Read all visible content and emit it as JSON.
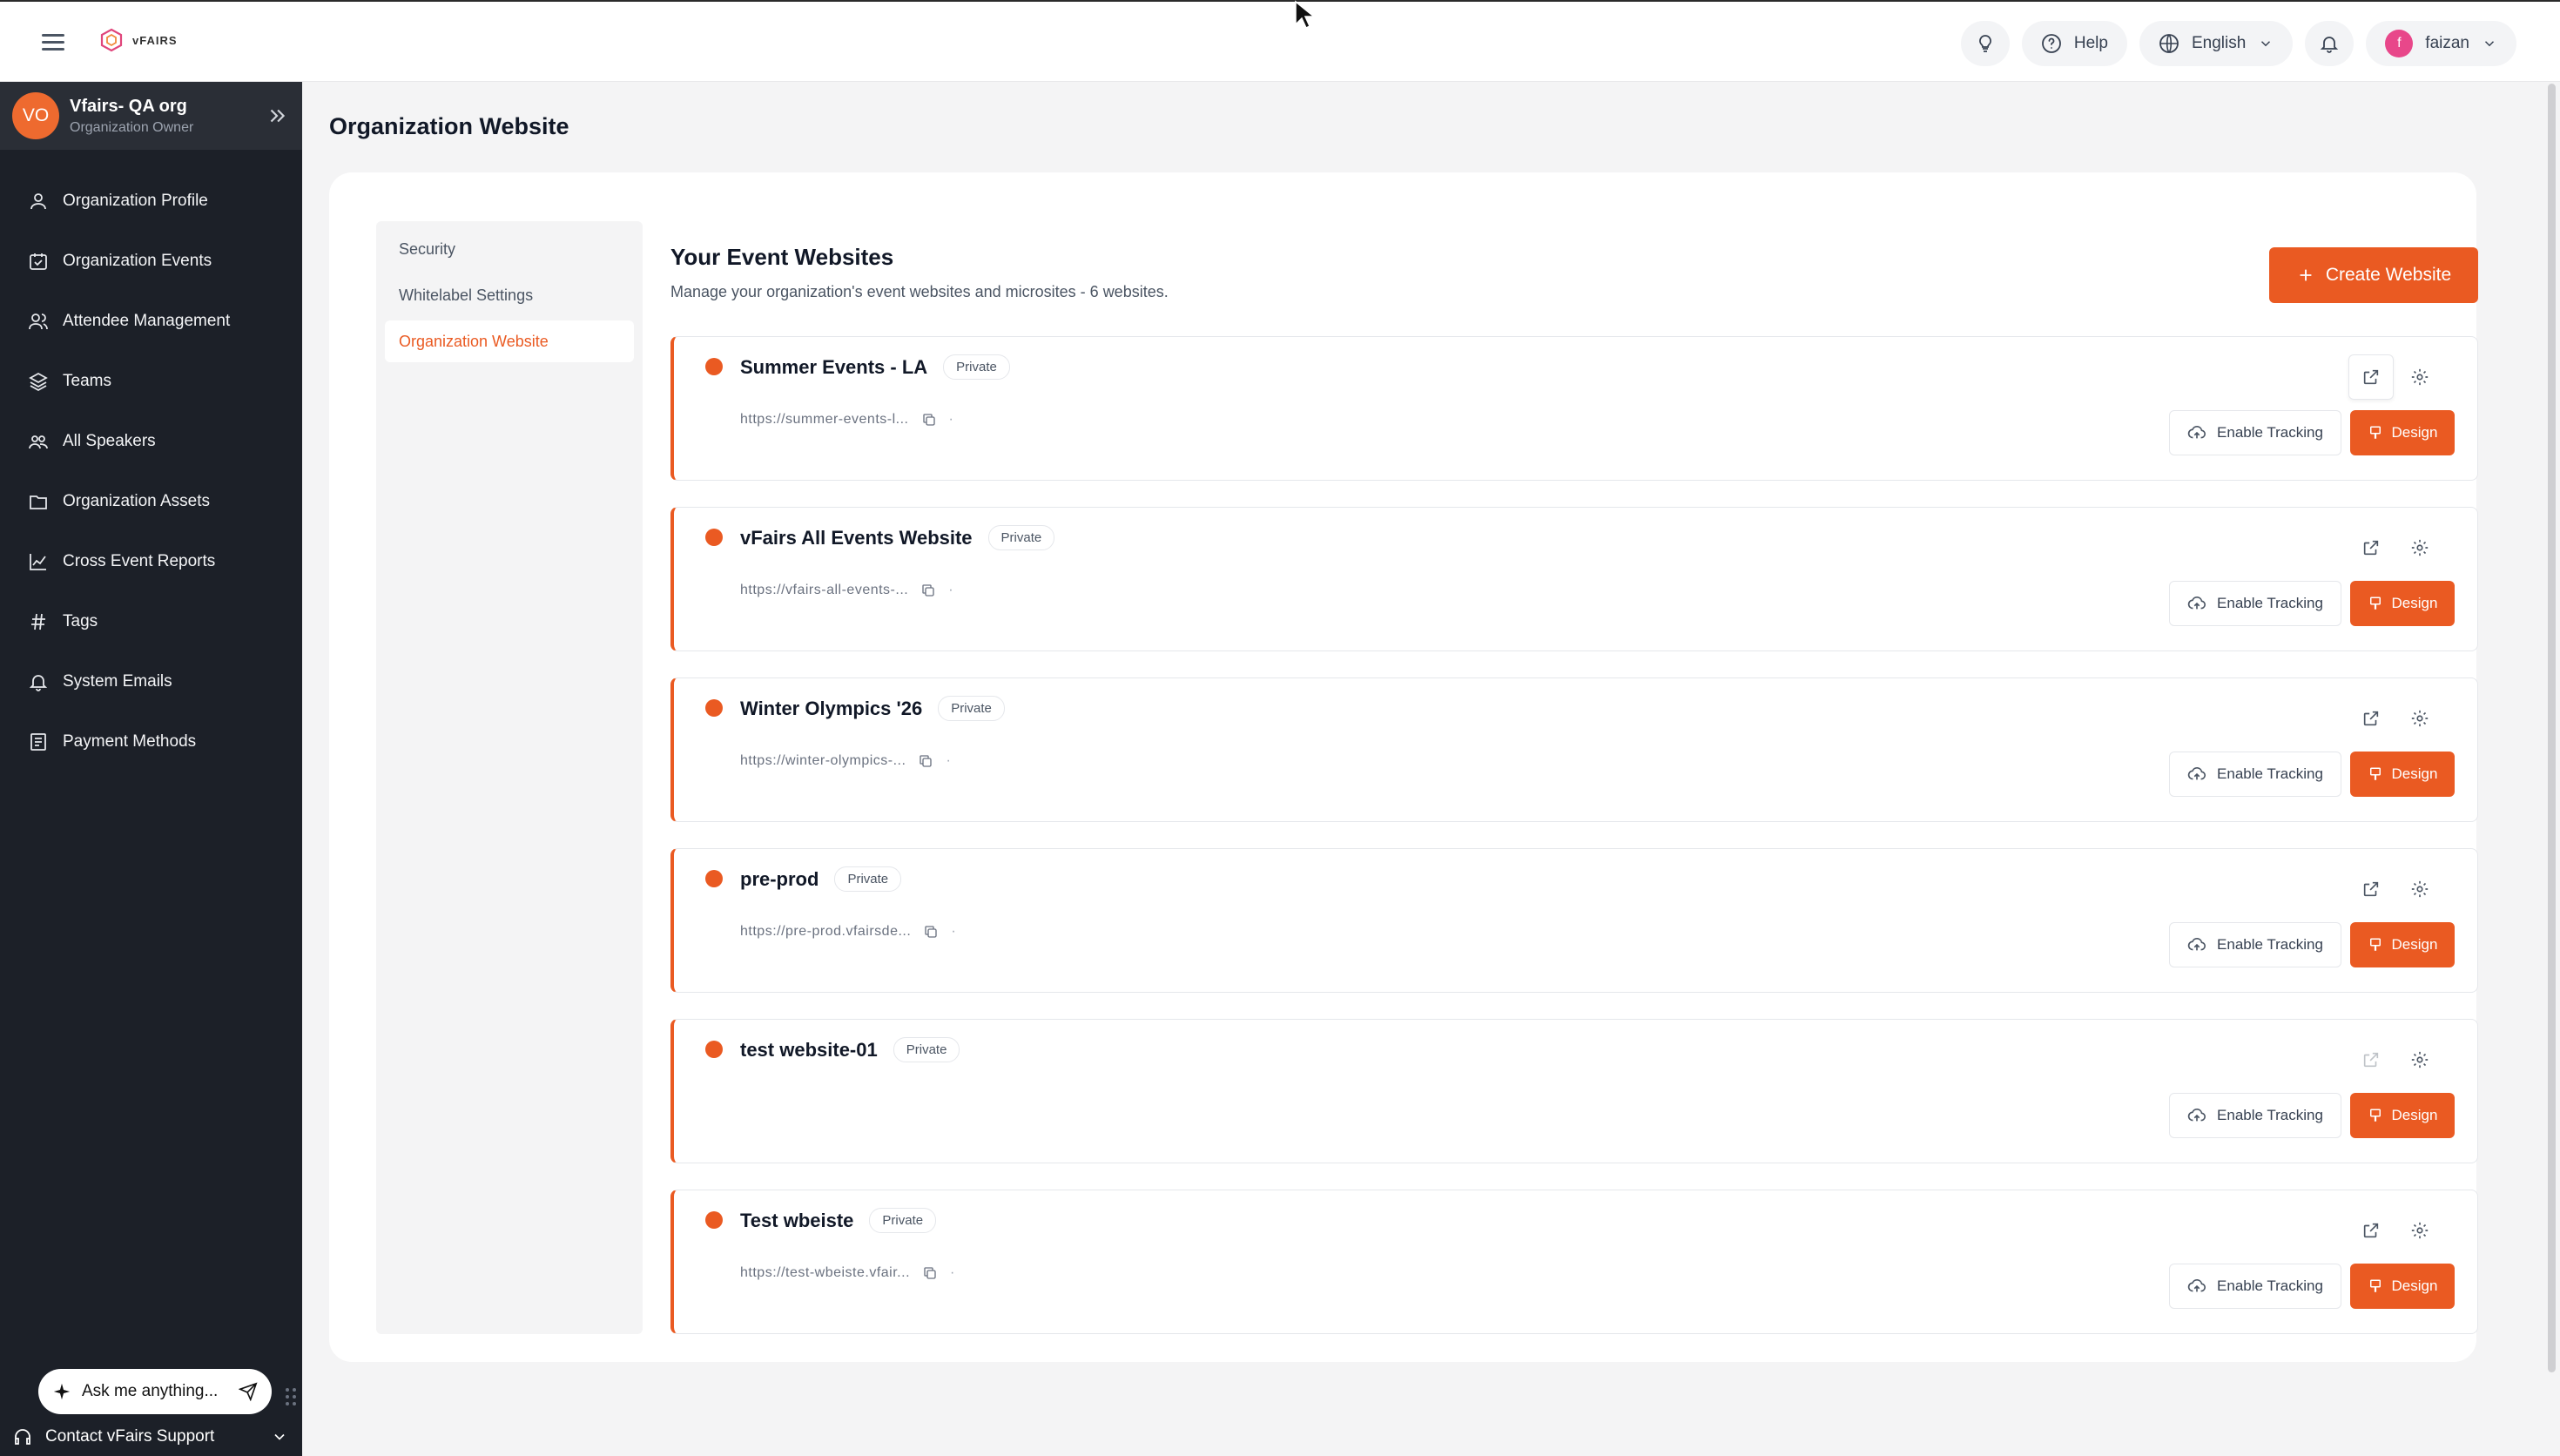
{
  "topbar": {
    "logo_text": "vFAIRS",
    "help_label": "Help",
    "language_label": "English",
    "user_initial": "f",
    "user_name": "faizan"
  },
  "sidebar": {
    "org_initials": "VO",
    "org_name": "Vfairs- QA org",
    "org_role": "Organization Owner",
    "items": [
      {
        "label": "Organization Profile",
        "icon": "user-icon"
      },
      {
        "label": "Organization Events",
        "icon": "calendar-check-icon"
      },
      {
        "label": "Attendee Management",
        "icon": "users-icon"
      },
      {
        "label": "Teams",
        "icon": "layers-icon"
      },
      {
        "label": "All Speakers",
        "icon": "speakers-icon"
      },
      {
        "label": "Organization Assets",
        "icon": "folder-icon"
      },
      {
        "label": "Cross Event Reports",
        "icon": "chart-line-icon"
      },
      {
        "label": "Tags",
        "icon": "hash-icon"
      },
      {
        "label": "System Emails",
        "icon": "bell-icon"
      },
      {
        "label": "Payment Methods",
        "icon": "receipt-icon"
      }
    ],
    "ask_placeholder": "Ask me anything...",
    "support_label": "Contact vFairs Support"
  },
  "page": {
    "title": "Organization Website"
  },
  "subnav": {
    "items": [
      {
        "label": "Security"
      },
      {
        "label": "Whitelabel Settings"
      },
      {
        "label": "Organization Website"
      }
    ],
    "active": "Organization Website"
  },
  "content": {
    "title": "Your Event Websites",
    "subtitle": "Manage your organization's event websites and microsites - 6 websites.",
    "create_label": "Create Website",
    "track_label": "Enable Tracking",
    "design_label": "Design",
    "sites": [
      {
        "name": "Summer Events - LA",
        "badge": "Private",
        "url": "https://summer-events-l..."
      },
      {
        "name": "vFairs All Events Website",
        "badge": "Private",
        "url": "https://vfairs-all-events-..."
      },
      {
        "name": "Winter Olympics '26",
        "badge": "Private",
        "url": "https://winter-olympics-..."
      },
      {
        "name": "pre-prod",
        "badge": "Private",
        "url": "https://pre-prod.vfairsde..."
      },
      {
        "name": "test website-01",
        "badge": "Private",
        "url": ""
      },
      {
        "name": "Test wbeiste",
        "badge": "Private",
        "url": "https://test-wbeiste.vfair..."
      }
    ]
  },
  "colors": {
    "accent": "#ea5a22",
    "sidebar_bg": "#1c2028",
    "org_avatar": "#ee6a2f",
    "user_avatar": "#e8478a"
  }
}
